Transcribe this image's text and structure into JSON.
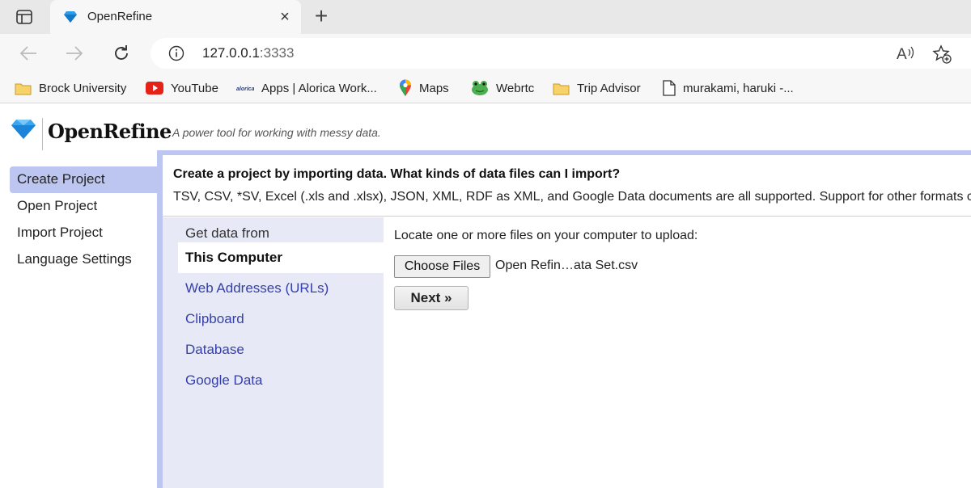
{
  "browser": {
    "tab": {
      "title": "OpenRefine",
      "close": "×"
    },
    "new_tab": "+",
    "address": {
      "host": "127.0.0.1",
      "port": ":3333"
    },
    "bookmarks": [
      {
        "label": "Brock University",
        "icon": "folder-icon"
      },
      {
        "label": "YouTube",
        "icon": "youtube-icon"
      },
      {
        "label": "Apps | Alorica Work...",
        "icon": "alorica-icon"
      },
      {
        "label": "Maps",
        "icon": "maps-pin-icon"
      },
      {
        "label": "Webrtc",
        "icon": "frog-icon"
      },
      {
        "label": "Trip Advisor",
        "icon": "folder-icon"
      },
      {
        "label": "murakami, haruki -...",
        "icon": "document-icon"
      }
    ]
  },
  "app": {
    "name": "OpenRefine",
    "tagline": "A power tool for working with messy data.",
    "nav": [
      "Create Project",
      "Open Project",
      "Import Project",
      "Language Settings"
    ],
    "intro": {
      "title": "Create a project by importing data. What kinds of data files can I import?",
      "description": "TSV, CSV, *SV, Excel (.xls and .xlsx), JSON, XML, RDF as XML, and Google Data documents are all supported. Support for other formats can be added with OpenRefine extensions."
    },
    "sources": {
      "heading": "Get data from",
      "items": [
        "This Computer",
        "Web Addresses (URLs)",
        "Clipboard",
        "Database",
        "Google Data"
      ]
    },
    "upload": {
      "label": "Locate one or more files on your computer to upload:",
      "choose_files": "Choose Files",
      "file_name": "Open Refin…ata Set.csv",
      "next": "Next »"
    }
  },
  "colors": {
    "accent": "#bdc6f0",
    "source_bg": "#e7e9f6",
    "link": "#3540a8"
  }
}
